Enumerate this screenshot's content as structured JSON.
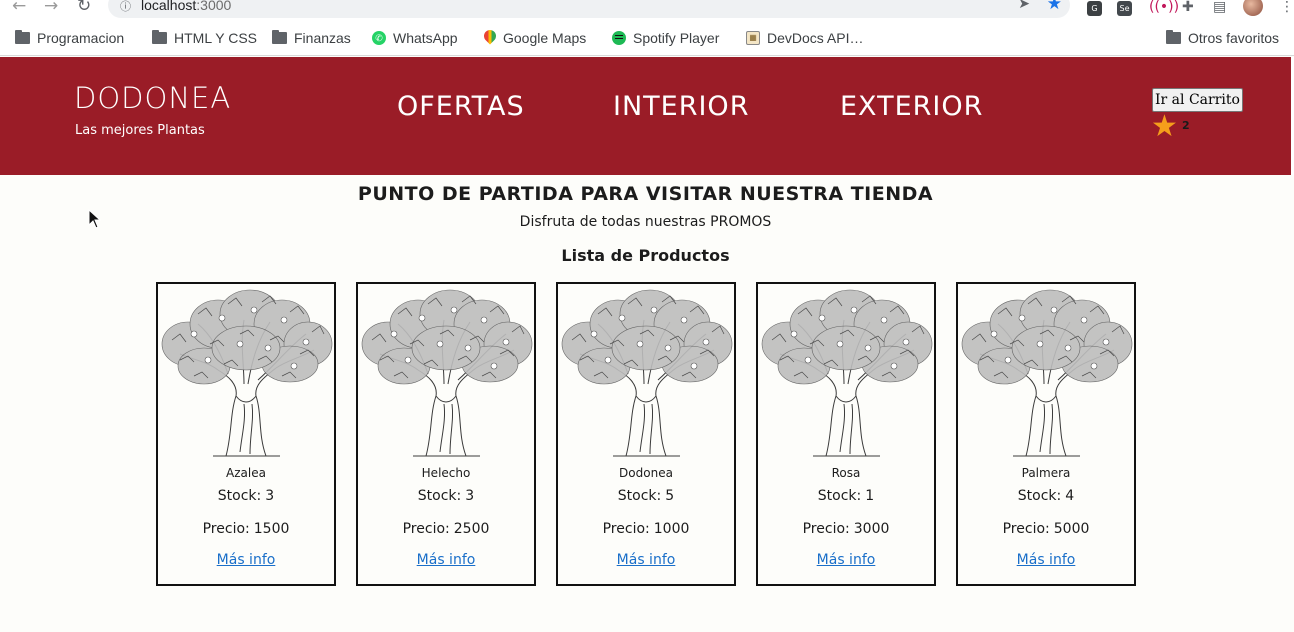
{
  "browser": {
    "url_host": "localhost",
    "url_port": ":3000",
    "bookmarks": [
      {
        "label": "Programacion",
        "icon": "folder-icon"
      },
      {
        "label": "HTML Y CSS",
        "icon": "folder-icon"
      },
      {
        "label": "Finanzas",
        "icon": "folder-icon"
      },
      {
        "label": "WhatsApp",
        "icon": "whatsapp-icon"
      },
      {
        "label": "Google Maps",
        "icon": "google-maps-icon"
      },
      {
        "label": "Spotify Player",
        "icon": "spotify-icon"
      },
      {
        "label": "DevDocs API…",
        "icon": "devdocs-icon"
      }
    ],
    "other_bookmarks": "Otros favoritos"
  },
  "header": {
    "brand": "DODONEA",
    "tagline": "Las mejores Plantas",
    "nav": [
      "OFERTAS",
      "INTERIOR",
      "EXTERIOR"
    ],
    "cart_button": "Ir al Carrito",
    "cart_count": "2",
    "accent_color": "#9a1c27"
  },
  "main": {
    "title": "PUNTO DE PARTIDA PARA VISITAR NUESTRA TIENDA",
    "subtitle": "Disfruta de todas nuestras PROMOS",
    "list_title": "Lista de Productos"
  },
  "products": [
    {
      "name": "Azalea",
      "stock_label": "Stock:",
      "stock": "3",
      "price_label": "Precio:",
      "price": "1500",
      "link": "Más info"
    },
    {
      "name": "Helecho",
      "stock_label": "Stock:",
      "stock": "3",
      "price_label": "Precio:",
      "price": "2500",
      "link": "Más info"
    },
    {
      "name": "Dodonea",
      "stock_label": "Stock:",
      "stock": "5",
      "price_label": "Precio:",
      "price": "1000",
      "link": "Más info"
    },
    {
      "name": "Rosa",
      "stock_label": "Stock:",
      "stock": "1",
      "price_label": "Precio:",
      "price": "3000",
      "link": "Más info"
    },
    {
      "name": "Palmera",
      "stock_label": "Stock:",
      "stock": "4",
      "price_label": "Precio:",
      "price": "5000",
      "link": "Más info"
    }
  ]
}
